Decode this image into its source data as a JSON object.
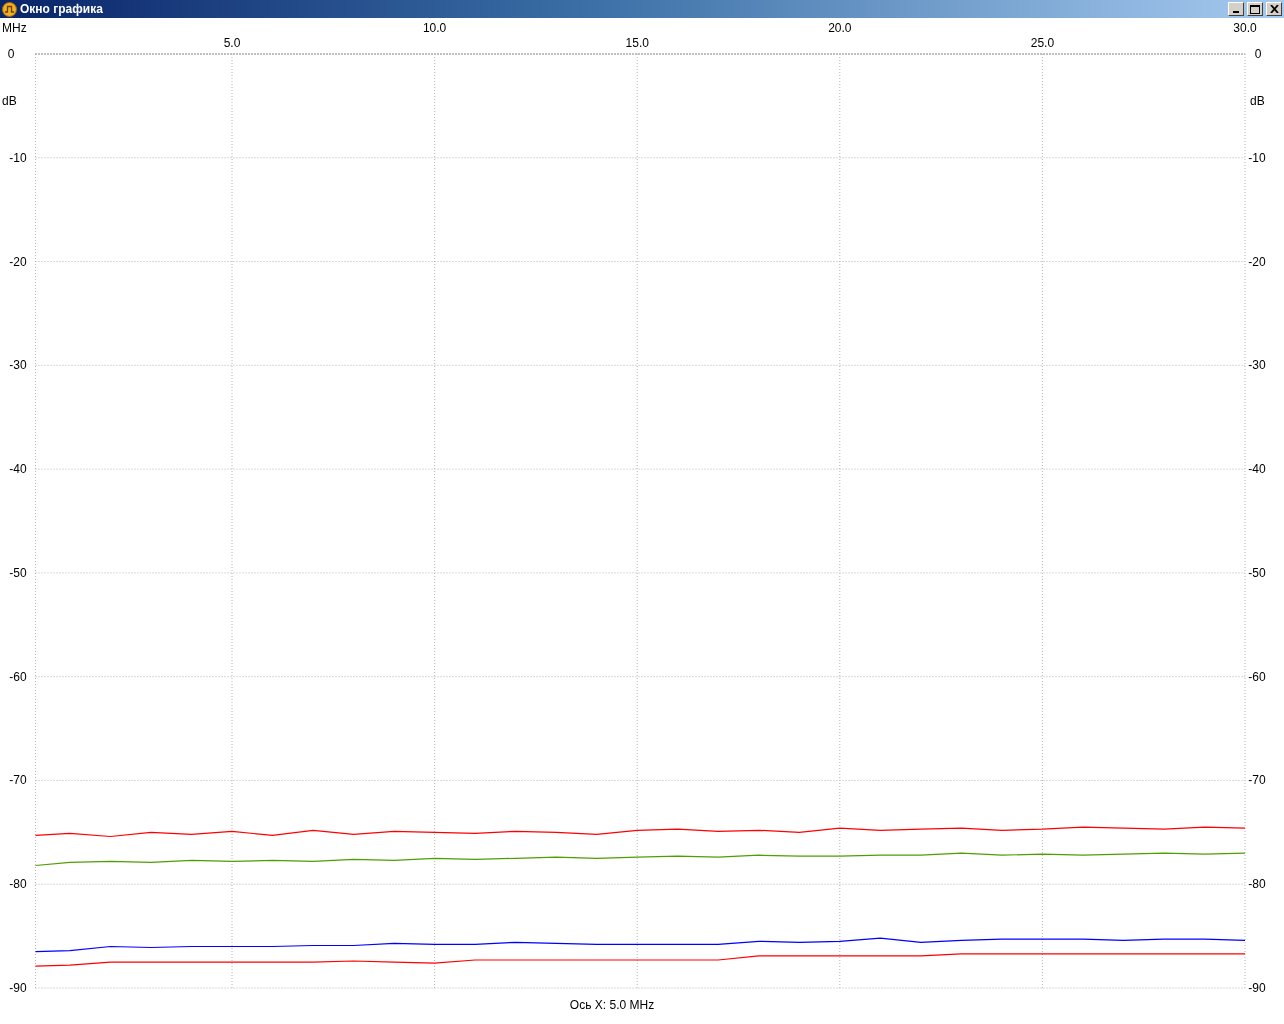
{
  "window": {
    "title": "Окно графика"
  },
  "chart": {
    "chart_data": {
      "type": "line",
      "grid": true,
      "xlabel": "MHz",
      "ylabel": "dB",
      "xlim": [
        0.15,
        30
      ],
      "ylim": [
        -90,
        0
      ],
      "xticks": [
        {
          "value": 10,
          "label": "10.0"
        },
        {
          "value": 20,
          "label": "20.0"
        },
        {
          "value": 30,
          "label": "30.0"
        }
      ],
      "yticks": [
        0,
        -10,
        -20,
        -30,
        -40,
        -50,
        -60,
        -70,
        -80,
        -90
      ],
      "x": [
        0.15,
        1,
        2,
        3,
        4,
        5,
        6,
        7,
        8,
        9,
        10,
        11,
        12,
        13,
        14,
        15,
        16,
        17,
        18,
        19,
        20,
        21,
        22,
        23,
        24,
        25,
        26,
        27,
        28,
        29,
        30
      ],
      "series": [
        {
          "color": "#ff0000",
          "values": [
            -75.3,
            -75.1,
            -75.4,
            -75.0,
            -75.2,
            -74.9,
            -75.3,
            -74.8,
            -75.2,
            -74.9,
            -75.0,
            -75.1,
            -74.9,
            -75.0,
            -75.2,
            -74.8,
            -74.7,
            -74.9,
            -74.8,
            -75.0,
            -74.6,
            -74.8,
            -74.7,
            -74.6,
            -74.8,
            -74.7,
            -74.5,
            -74.6,
            -74.7,
            -74.5,
            -74.6
          ]
        },
        {
          "color": "#4f9e00",
          "values": [
            -78.2,
            -77.9,
            -77.8,
            -77.9,
            -77.7,
            -77.8,
            -77.7,
            -77.8,
            -77.6,
            -77.7,
            -77.5,
            -77.6,
            -77.5,
            -77.4,
            -77.5,
            -77.4,
            -77.3,
            -77.4,
            -77.2,
            -77.3,
            -77.3,
            -77.2,
            -77.2,
            -77.0,
            -77.2,
            -77.1,
            -77.2,
            -77.1,
            -77.0,
            -77.1,
            -77.0
          ]
        },
        {
          "color": "#0000ff",
          "values": [
            -86.5,
            -86.4,
            -86.0,
            -86.1,
            -86.0,
            -86.0,
            -86.0,
            -85.9,
            -85.9,
            -85.7,
            -85.8,
            -85.8,
            -85.6,
            -85.7,
            -85.8,
            -85.8,
            -85.8,
            -85.8,
            -85.5,
            -85.6,
            -85.5,
            -85.2,
            -85.6,
            -85.4,
            -85.3,
            -85.3,
            -85.3,
            -85.4,
            -85.3,
            -85.3,
            -85.4
          ]
        },
        {
          "color": "#ff0000",
          "values": [
            -87.9,
            -87.8,
            -87.5,
            -87.5,
            -87.5,
            -87.5,
            -87.5,
            -87.5,
            -87.4,
            -87.5,
            -87.6,
            -87.3,
            -87.3,
            -87.3,
            -87.3,
            -87.3,
            -87.3,
            -87.3,
            -86.9,
            -86.9,
            -86.9,
            -86.9,
            -86.9,
            -86.7,
            -86.7,
            -86.7,
            -86.7,
            -86.7,
            -86.7,
            -86.7,
            -86.7
          ]
        }
      ]
    },
    "midpoint_labels": [
      "5.0",
      "15.0",
      "25.0"
    ],
    "left_scale": {
      "labels": [
        "0",
        "-10",
        "-20",
        "-30",
        "-40",
        "-50",
        "-60",
        "-70",
        "-80",
        "-90"
      ]
    },
    "right_scale": {
      "unit": "dB",
      "labels": [
        "0",
        "-10",
        "-20",
        "-30",
        "-40",
        "-50",
        "-60",
        "-70",
        "-80",
        "-90"
      ]
    },
    "caption": "Ось X: 5.0 MHz"
  }
}
